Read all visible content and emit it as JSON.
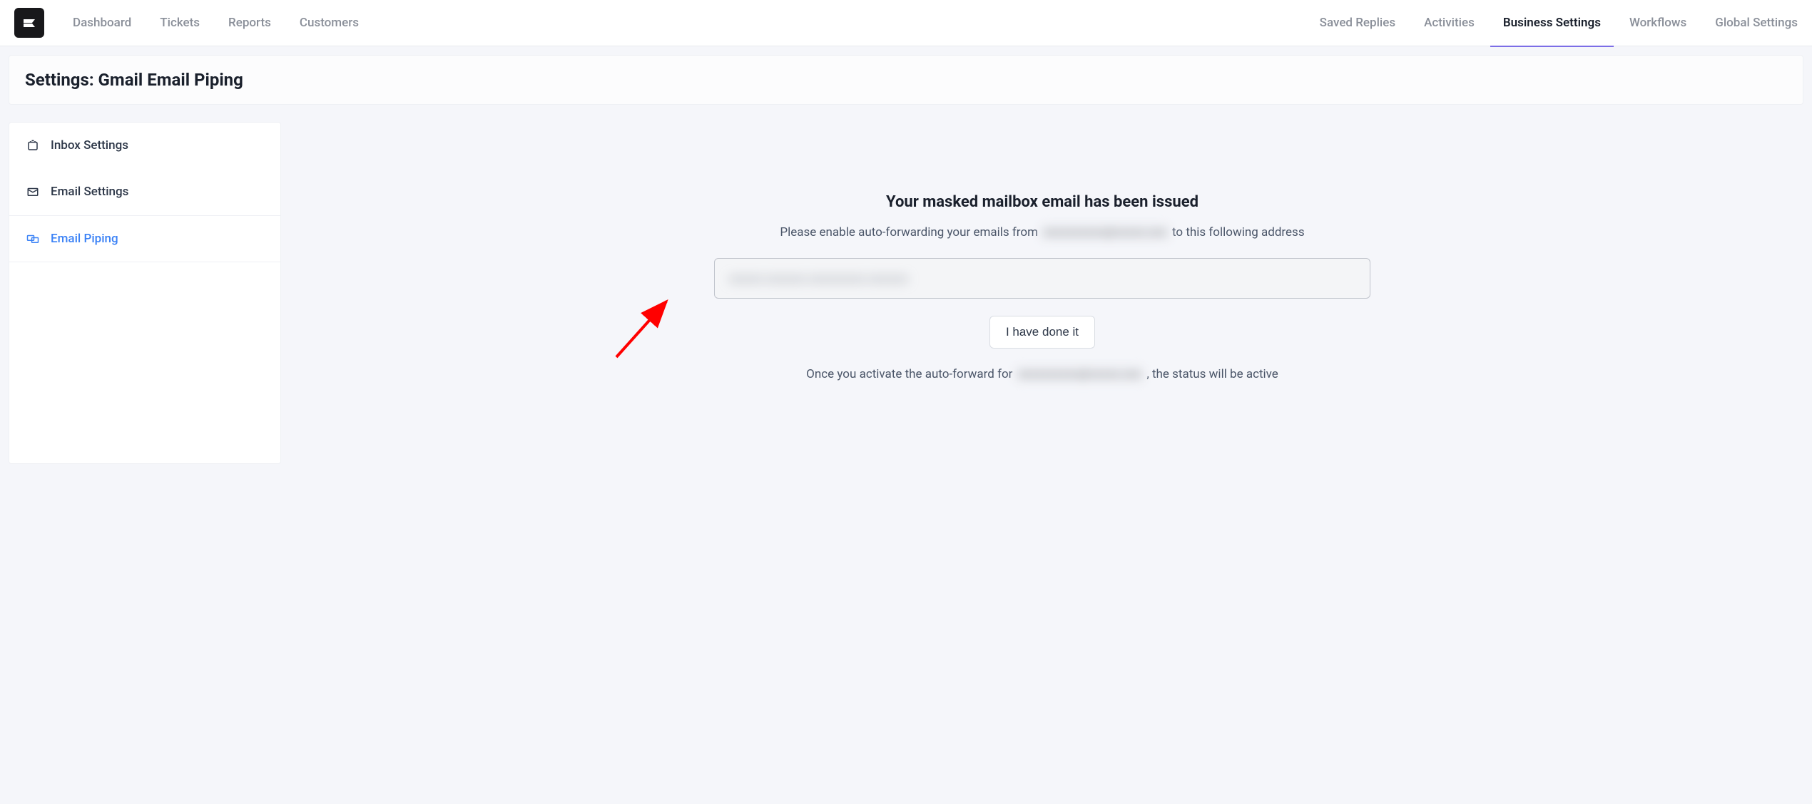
{
  "topnav": {
    "left": [
      "Dashboard",
      "Tickets",
      "Reports",
      "Customers"
    ],
    "right": [
      "Saved Replies",
      "Activities",
      "Business Settings",
      "Workflows",
      "Global Settings"
    ],
    "activeRight": "Business Settings"
  },
  "page": {
    "title": "Settings: Gmail Email Piping"
  },
  "sidebar": {
    "items": [
      {
        "label": "Inbox Settings",
        "icon": "inbox",
        "active": false
      },
      {
        "label": "Email Settings",
        "icon": "mail",
        "active": false
      },
      {
        "label": "Email Piping",
        "icon": "pipe",
        "active": true
      }
    ]
  },
  "panel": {
    "heading": "Your masked mailbox email has been issued",
    "sub_prefix": "Please enable auto-forwarding your emails from ",
    "sub_blurred": "xxxxxxxxxx@xxxxx.xxx",
    "sub_suffix": " to this following address",
    "masked_value": "xxxxxx.xxxxxxx.xxxxxxxxxx.xxxxxxx",
    "done_button": "I have done it",
    "footer_prefix": "Once you activate the auto-forward for ",
    "footer_blurred": "xxxxxxxxxx@xxxxx.xxx",
    "footer_suffix": ", the status will be active"
  }
}
